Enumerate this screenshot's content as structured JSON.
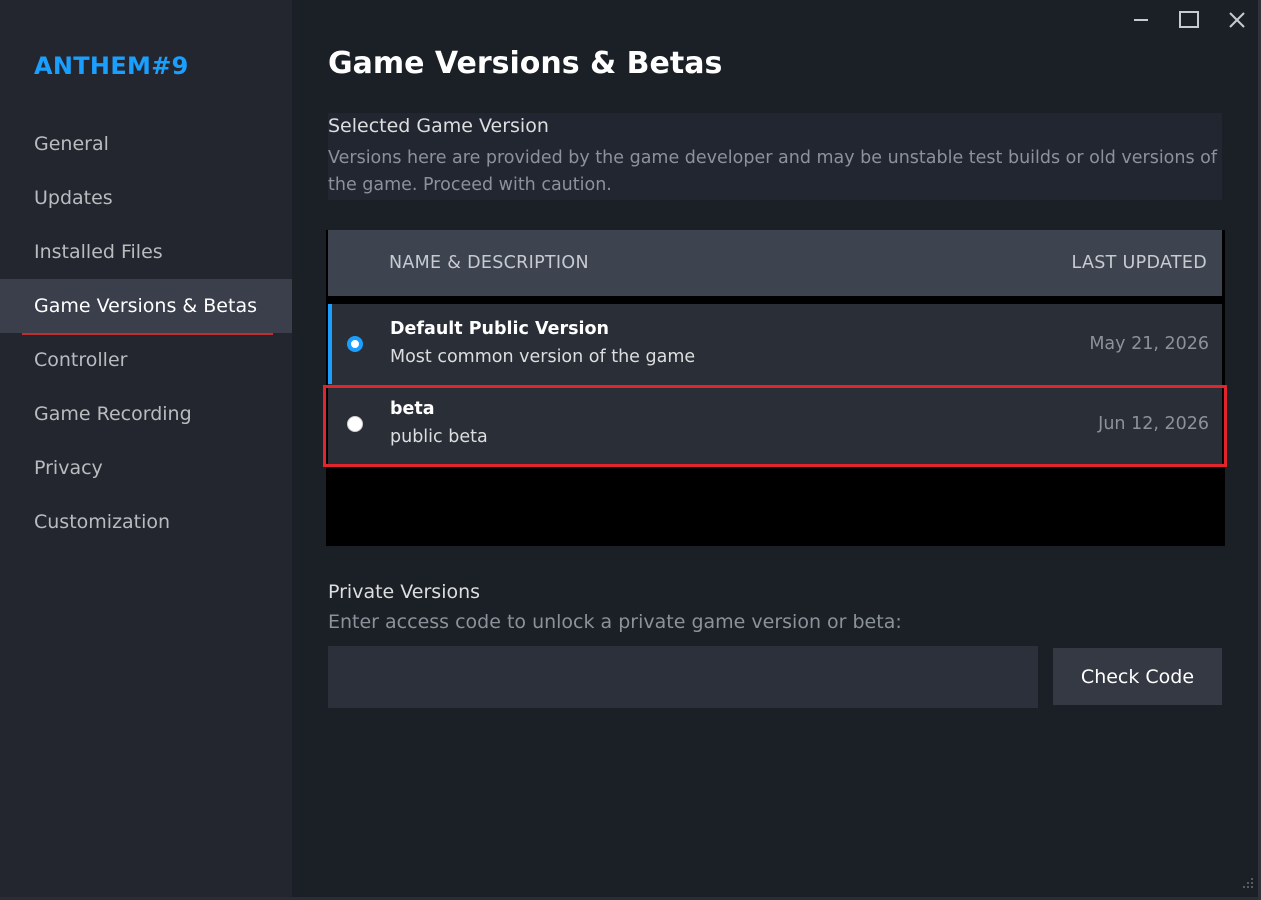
{
  "window": {
    "controls": {
      "minimize_icon": "minimize-icon",
      "maximize_icon": "maximize-icon",
      "close_icon": "close-icon"
    }
  },
  "sidebar": {
    "game_title": "ANTHEM#9",
    "items": [
      {
        "label": "General",
        "active": false
      },
      {
        "label": "Updates",
        "active": false
      },
      {
        "label": "Installed Files",
        "active": false
      },
      {
        "label": "Game Versions & Betas",
        "active": true
      },
      {
        "label": "Controller",
        "active": false
      },
      {
        "label": "Game Recording",
        "active": false
      },
      {
        "label": "Privacy",
        "active": false
      },
      {
        "label": "Customization",
        "active": false
      }
    ]
  },
  "main": {
    "title": "Game Versions & Betas",
    "selected_version": {
      "heading": "Selected Game Version",
      "description": "Versions here are provided by the game developer and may be unstable test builds or old versions of the game. Proceed with caution."
    },
    "table": {
      "col_name": "NAME & DESCRIPTION",
      "col_updated": "LAST UPDATED",
      "rows": [
        {
          "name": "Default Public Version",
          "description": "Most common version of the game",
          "updated": "May 21, 2026",
          "selected": true
        },
        {
          "name": "beta",
          "description": "public beta",
          "updated": "Jun 12, 2026",
          "selected": false
        }
      ]
    },
    "private_versions": {
      "heading": "Private Versions",
      "description": "Enter access code to unlock a private game version or beta:",
      "input_value": "",
      "button_label": "Check Code"
    }
  },
  "colors": {
    "accent": "#1a9fff",
    "highlight": "#e0262c",
    "sidebar_bg": "#23262e",
    "main_bg": "#1b1f26"
  }
}
